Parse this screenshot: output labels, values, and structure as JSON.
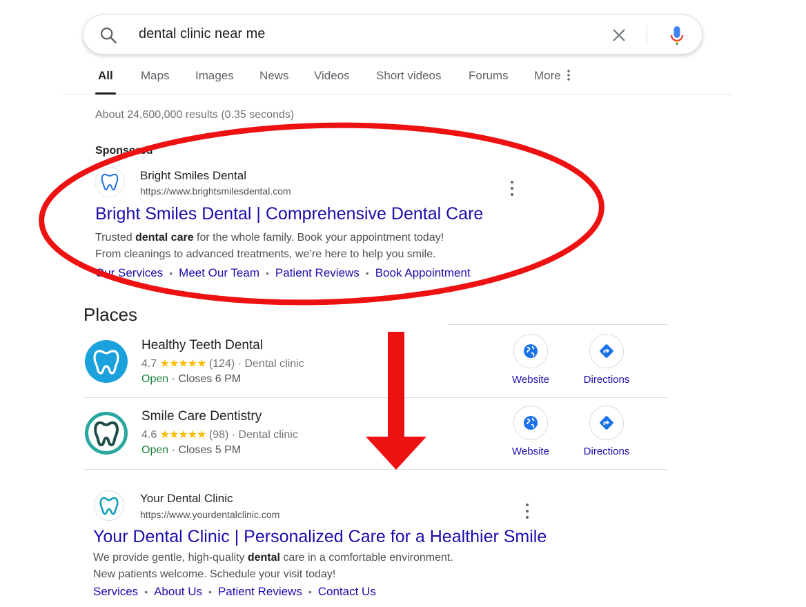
{
  "search": {
    "query": "dental clinic near me"
  },
  "tabs": [
    {
      "label": "All",
      "active": true
    },
    {
      "label": "Maps"
    },
    {
      "label": "Images"
    },
    {
      "label": "News"
    },
    {
      "label": "Videos"
    },
    {
      "label": "Short videos"
    },
    {
      "label": "Forums"
    },
    {
      "label": "More"
    }
  ],
  "stats": "About 24,600,000 results (0.35 seconds)",
  "ad": {
    "sponsored_label": "Sponsored",
    "site_name": "Bright Smiles Dental",
    "url": "https://www.brightsmilesdental.com",
    "title": "Bright Smiles Dental | Comprehensive Dental Care",
    "snippet_line1_pre": "Trusted ",
    "snippet_line1_bold1": "dental",
    "snippet_line1_mid": " ",
    "snippet_line1_bold2": "care",
    "snippet_line1_post": " for the whole family. Book your appointment today!",
    "snippet_line2": "From cleanings to advanced treatments, we’re here to help you smile.",
    "sitelinks": [
      "Our Services",
      "Meet Our Team",
      "Patient Reviews",
      "Book Appointment"
    ]
  },
  "places": {
    "heading": "Places",
    "items": [
      {
        "name": "Healthy Teeth Dental",
        "rating": "4.7",
        "stars": "★★★★★",
        "reviews": "(124)",
        "category": "· Dental clinic",
        "status": "Open",
        "hours": "· Closes 6 PM",
        "website_label": "Website",
        "directions_label": "Directions"
      },
      {
        "name": "Smile Care Dentistry",
        "rating": "4.6",
        "stars": "★★★★★",
        "reviews": "(98)",
        "category": "· Dental clinic",
        "status": "Open",
        "hours": "· Closes 5 PM",
        "website_label": "Website",
        "directions_label": "Directions"
      }
    ]
  },
  "organic": {
    "site_name": "Your Dental Clinic",
    "url": "https://www.yourdentalclinic.com",
    "title": "Your Dental Clinic | Personalized Care for a Healthier Smile",
    "snippet_line1_pre": "We provide gentle, high-quality ",
    "snippet_line1_bold": "dental",
    "snippet_line1_post": " care in a comfortable environment.",
    "snippet_line2": "New patients welcome. Schedule your visit today!",
    "sitelinks": [
      "Services",
      "About Us",
      "Patient Reviews",
      "Contact Us"
    ]
  },
  "colors": {
    "link": "#1a0dab",
    "annotation_red": "#ee1111",
    "open_green": "#188038",
    "star_yellow": "#fbbc04",
    "place1_logo": "#1ba1dc",
    "place2_ring": "#2aa7a0"
  },
  "icons": [
    "search-icon",
    "clear-icon",
    "mic-icon",
    "more-vert-icon",
    "tooth-icon",
    "globe-icon",
    "directions-icon"
  ]
}
